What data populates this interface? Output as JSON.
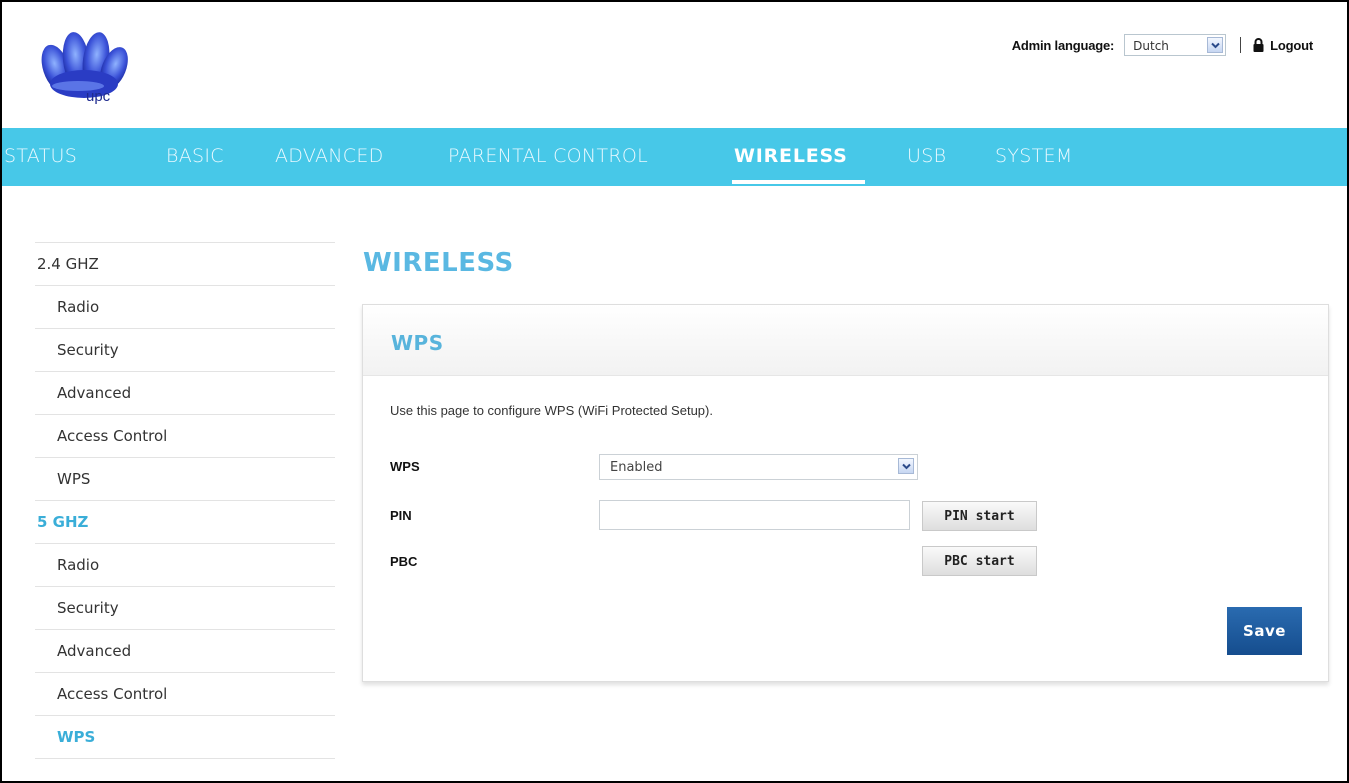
{
  "header": {
    "logo_text": "upc",
    "admin_language_label": "Admin language:",
    "admin_language_value": "Dutch",
    "logout_label": "Logout"
  },
  "nav": {
    "items": [
      {
        "label": "STATUS"
      },
      {
        "label": "BASIC"
      },
      {
        "label": "ADVANCED"
      },
      {
        "label": "PARENTAL CONTROL"
      },
      {
        "label": "WIRELESS",
        "active": true
      },
      {
        "label": "USB"
      },
      {
        "label": "SYSTEM"
      }
    ]
  },
  "sidebar": {
    "items": [
      {
        "label": "2.4 GHZ"
      },
      {
        "label": "Radio"
      },
      {
        "label": "Security"
      },
      {
        "label": "Advanced"
      },
      {
        "label": "Access Control"
      },
      {
        "label": "WPS"
      },
      {
        "label": "5 GHZ"
      },
      {
        "label": "Radio"
      },
      {
        "label": "Security"
      },
      {
        "label": "Advanced"
      },
      {
        "label": "Access Control"
      },
      {
        "label": "WPS"
      }
    ]
  },
  "main": {
    "page_title": "WIRELESS",
    "panel_title": "WPS",
    "description": "Use this page to configure WPS (WiFi Protected Setup).",
    "wps_label": "WPS",
    "wps_value": "Enabled",
    "pin_label": "PIN",
    "pin_value": "",
    "pin_start_label": "PIN start",
    "pbc_label": "PBC",
    "pbc_start_label": "PBC start",
    "save_label": "Save"
  },
  "colors": {
    "nav_background": "#47c8e8",
    "accent_blue": "#5ab8e2",
    "save_button": "#1c5a9e"
  },
  "icons": [
    "upc-logo",
    "chevron-down-icon",
    "lock-icon"
  ]
}
